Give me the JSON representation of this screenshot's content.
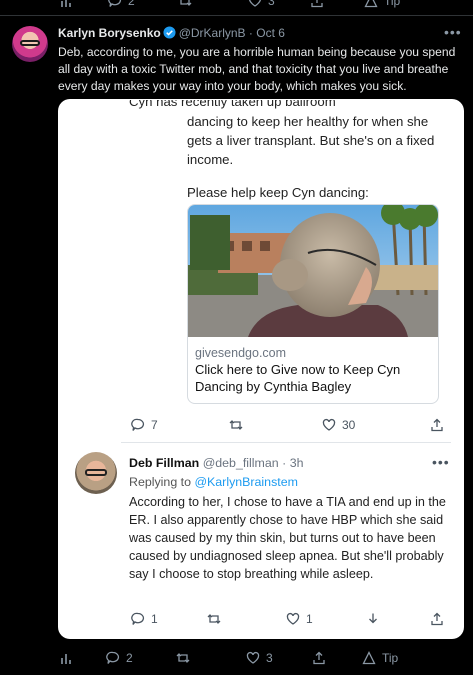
{
  "top_actions": {
    "replies": "2",
    "retweets": "",
    "likes": "3",
    "tip": "Tip"
  },
  "tweet": {
    "name": "Karlyn Borysenko",
    "handle": "@DrKarlynB",
    "sep": "·",
    "time": "Oct 6",
    "text": "Deb, according to me, you are a horrible human being because you spend all day with a toxic Twitter mob, and that toxicity that you live and breathe every day makes your way into your body, which makes you sick."
  },
  "embedded_top": {
    "line1": "Cyn has recently taken up ballroom",
    "line2": "dancing to keep her healthy for when she gets a liver transplant. But she's on a fixed income.",
    "line3": "Please help keep Cyn dancing:"
  },
  "link_card": {
    "domain": "givesendgo.com",
    "title": "Click here to Give now to Keep Cyn Dancing by Cynthia Bagley"
  },
  "embedded_actions": {
    "replies": "7",
    "likes": "30"
  },
  "reply": {
    "name": "Deb Fillman",
    "handle": "@deb_fillman",
    "sep": "·",
    "time": "3h",
    "replying_prefix": "Replying to",
    "replying_to": "@KarlynBrainstem",
    "text": "According to her, I chose to have a TIA and end up in the ER. I also apparently chose to have HBP which she said was caused by my thin skin, but turns out to have been caused by undiagnosed sleep apnea. But she'll probably say I choose to stop breathing while asleep.",
    "replies": "1",
    "likes": "1"
  },
  "bottom_actions": {
    "replies": "2",
    "likes": "3",
    "tip": "Tip"
  },
  "colors": {
    "background": "#000000",
    "accent": "#1d9bf0",
    "muted": "#8b98a5",
    "card": "#ffffff"
  }
}
